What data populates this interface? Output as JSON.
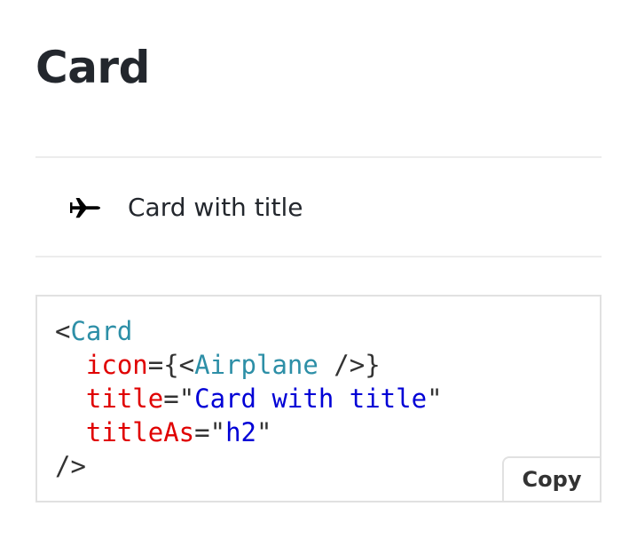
{
  "page": {
    "title": "Card"
  },
  "demo": {
    "icon": "airplane-icon",
    "title": "Card with title"
  },
  "code_sample": {
    "line1_open": "<",
    "line1_tag": "Card",
    "line2_indent": "  ",
    "line2_attr": "icon",
    "line2_eq_open": "={<",
    "line2_component": "Airplane",
    "line2_close": " />}",
    "line3_indent": "  ",
    "line3_attr": "title",
    "line3_eq": "=\"",
    "line3_value": "Card with title",
    "line3_quote": "\"",
    "line4_indent": "  ",
    "line4_attr": "titleAs",
    "line4_eq": "=\"",
    "line4_value": "h2",
    "line4_quote": "\"",
    "line5_close": "/>"
  },
  "actions": {
    "copy_label": "Copy"
  },
  "colors": {
    "tag": "#2d8fa7",
    "attribute": "#e00000",
    "string": "#0000d6",
    "punctuation": "#333333"
  }
}
